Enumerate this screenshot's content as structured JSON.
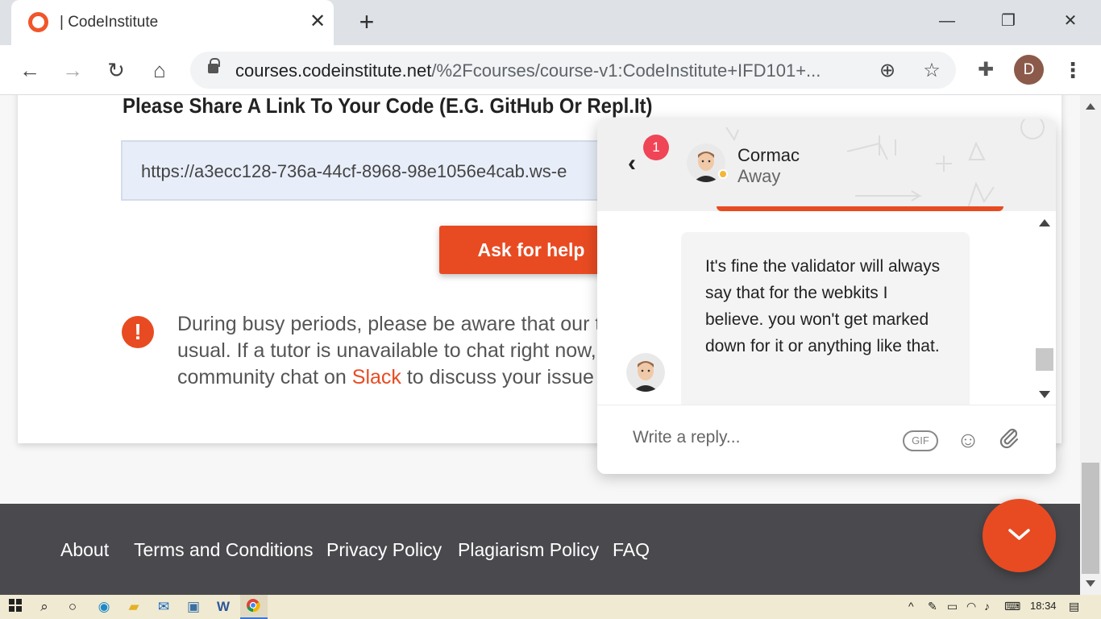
{
  "browser": {
    "tab_title": "| CodeInstitute",
    "url_host": "courses.codeinstitute.net",
    "url_path": "/%2Fcourses/course-v1:CodeInstitute+IFD101+..."
  },
  "content": {
    "question": "Please Share A Link To Your Code (E.G. GitHub Or Repl.It)",
    "code_link_value": "https://a3ecc128-736a-44cf-8968-98e1056e4cab.ws-e",
    "ask_button": "Ask for help",
    "notice_line1": "During busy periods, please be aware that our tu",
    "notice_line2": "usual. If a tutor is unavailable to chat right now, w",
    "notice_line3_pre": "community chat on ",
    "notice_link": "Slack",
    "notice_line3_post": " to discuss your issue w"
  },
  "footer": {
    "links": [
      "About",
      "Terms and Conditions",
      "Privacy Policy",
      "Plagiarism Policy",
      "FAQ"
    ]
  },
  "chat": {
    "unread_badge": "1",
    "agent_name": "Cormac",
    "agent_status": "Away",
    "message": "It's fine the validator will always say that for the webkits I believe. you won't get marked down for it or anything like that.",
    "reply_placeholder": "Write a reply...",
    "gif_label": "GIF"
  },
  "taskbar": {
    "time": "18:34"
  },
  "colors": {
    "accent": "#e84b22",
    "footer_bg": "#4a4a4e",
    "badge": "#ef4556",
    "status_away": "#f3b63a"
  }
}
